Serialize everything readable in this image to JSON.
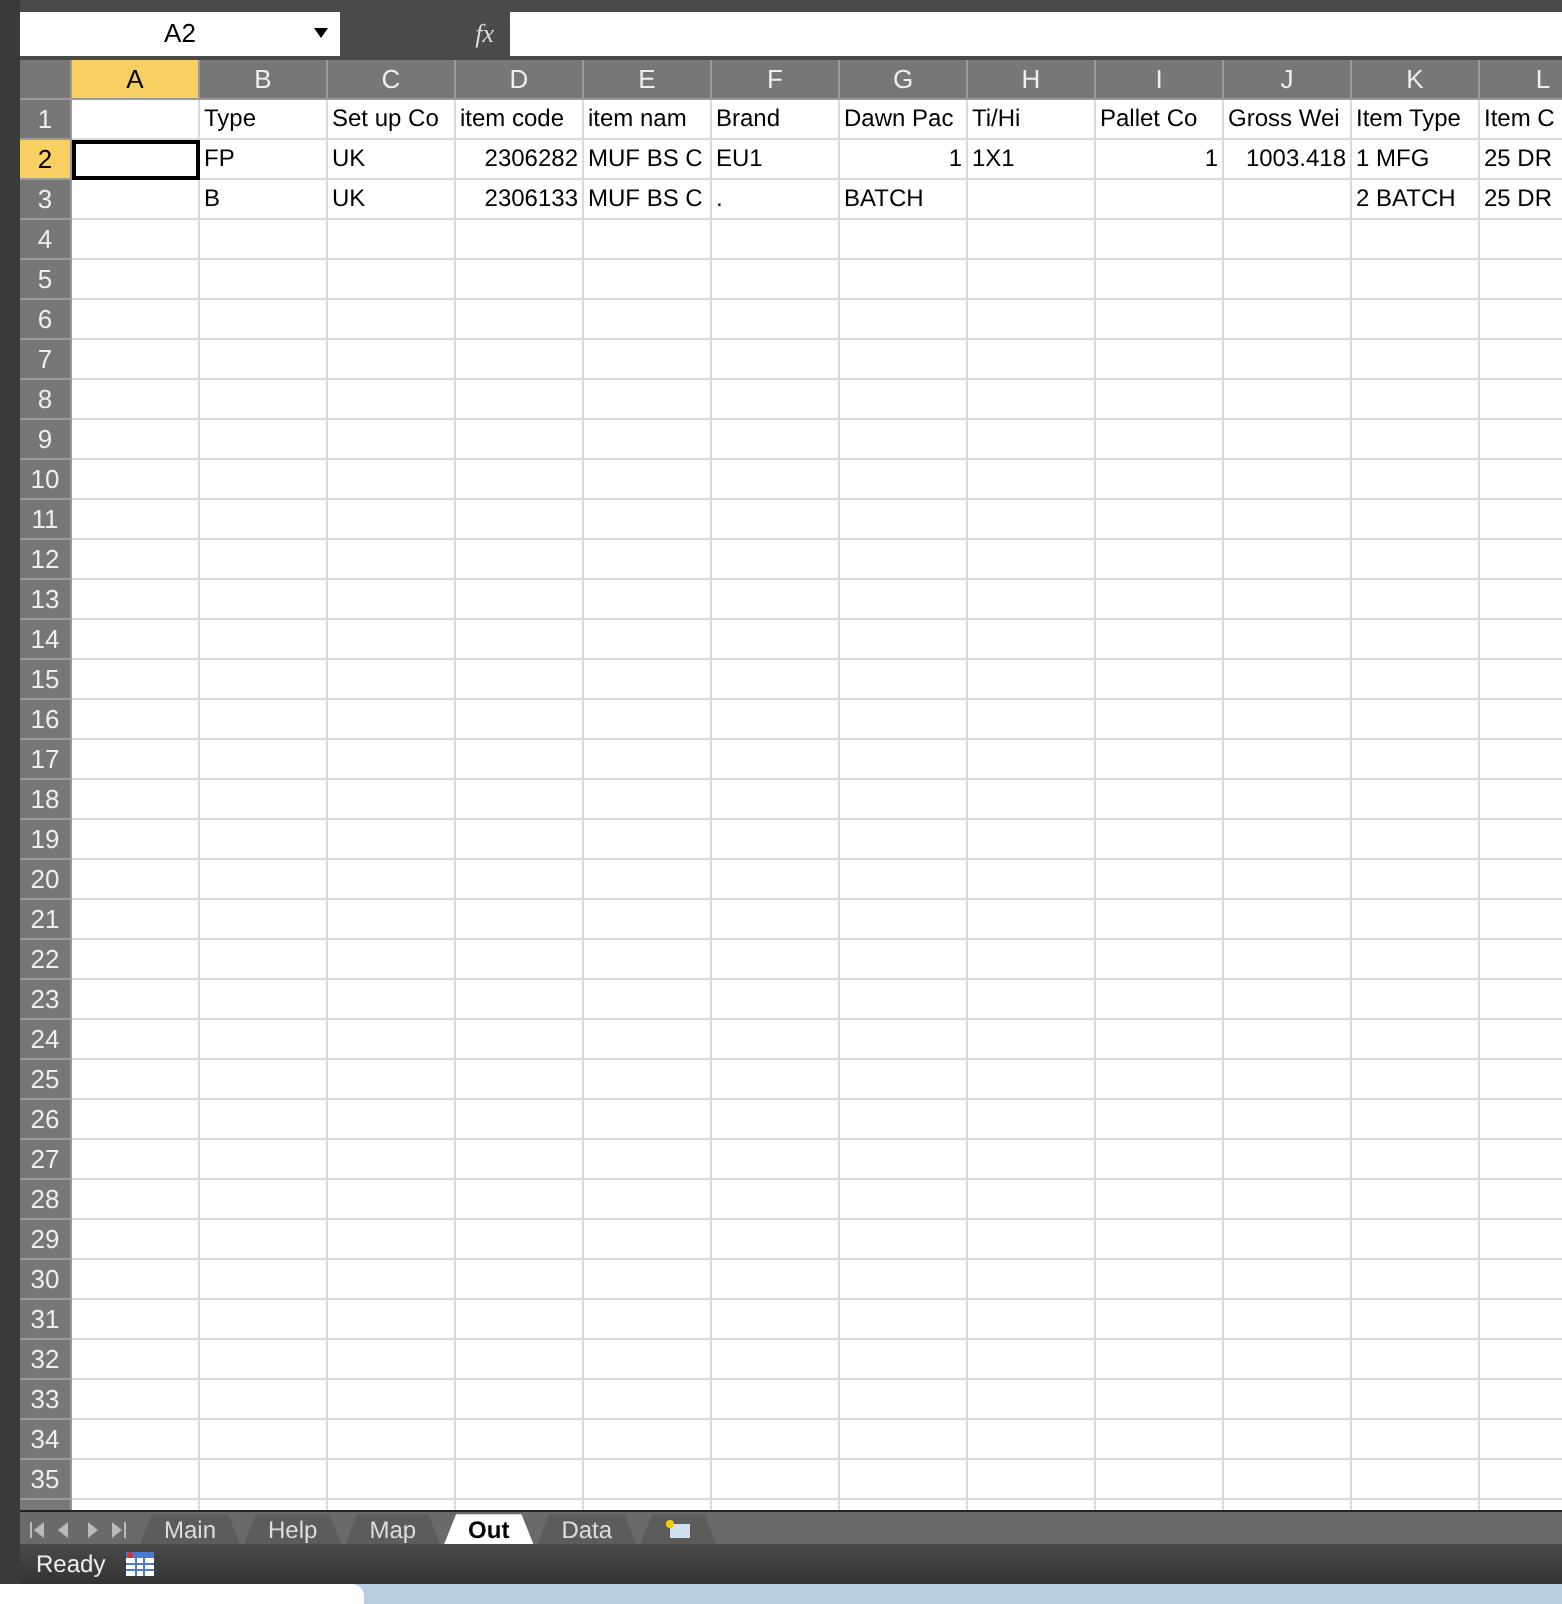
{
  "formula_bar": {
    "name_box": "A2",
    "function_label": "fx"
  },
  "columns": [
    {
      "label": "A",
      "selected": true
    },
    {
      "label": "B",
      "selected": false
    },
    {
      "label": "C",
      "selected": false
    },
    {
      "label": "D",
      "selected": false
    },
    {
      "label": "E",
      "selected": false
    },
    {
      "label": "F",
      "selected": false
    },
    {
      "label": "G",
      "selected": false
    },
    {
      "label": "H",
      "selected": false
    },
    {
      "label": "I",
      "selected": false
    },
    {
      "label": "J",
      "selected": false
    },
    {
      "label": "K",
      "selected": false
    },
    {
      "label": "L",
      "selected": false
    }
  ],
  "rows": [
    {
      "number": "1",
      "selected": false,
      "cells": {
        "B": {
          "text": "Type"
        },
        "C": {
          "text": "Set up Co"
        },
        "D": {
          "text": "item code"
        },
        "E": {
          "text": "item nam"
        },
        "F": {
          "text": "Brand"
        },
        "G": {
          "text": "Dawn Pac"
        },
        "H": {
          "text": "Ti/Hi"
        },
        "I": {
          "text": "Pallet Co"
        },
        "J": {
          "text": "Gross Wei"
        },
        "K": {
          "text": "Item Type"
        },
        "L": {
          "text": "Item C"
        }
      }
    },
    {
      "number": "2",
      "selected": true,
      "cells": {
        "B": {
          "text": "FP"
        },
        "C": {
          "text": "UK"
        },
        "D": {
          "text": "2306282",
          "numeric": true
        },
        "E": {
          "text": "MUF BS C"
        },
        "F": {
          "text": "EU1"
        },
        "G": {
          "text": "1",
          "numeric": true
        },
        "H": {
          "text": "1X1"
        },
        "I": {
          "text": "1",
          "numeric": true
        },
        "J": {
          "text": "1003.418",
          "numeric": true
        },
        "K": {
          "text": "1 MFG"
        },
        "L": {
          "text": "25 DR"
        }
      }
    },
    {
      "number": "3",
      "selected": false,
      "cells": {
        "B": {
          "text": "B"
        },
        "C": {
          "text": "UK"
        },
        "D": {
          "text": "2306133",
          "numeric": true
        },
        "E": {
          "text": "MUF BS C"
        },
        "F": {
          "text": "."
        },
        "G": {
          "text": "BATCH"
        },
        "K": {
          "text": "2 BATCH"
        },
        "L": {
          "text": "25 DR"
        }
      }
    },
    {
      "number": "4",
      "selected": false
    },
    {
      "number": "5",
      "selected": false
    },
    {
      "number": "6",
      "selected": false
    },
    {
      "number": "7",
      "selected": false
    },
    {
      "number": "8",
      "selected": false
    },
    {
      "number": "9",
      "selected": false
    },
    {
      "number": "10",
      "selected": false
    },
    {
      "number": "11",
      "selected": false
    },
    {
      "number": "12",
      "selected": false
    },
    {
      "number": "13",
      "selected": false
    },
    {
      "number": "14",
      "selected": false
    },
    {
      "number": "15",
      "selected": false
    },
    {
      "number": "16",
      "selected": false
    },
    {
      "number": "17",
      "selected": false
    },
    {
      "number": "18",
      "selected": false
    },
    {
      "number": "19",
      "selected": false
    },
    {
      "number": "20",
      "selected": false
    },
    {
      "number": "21",
      "selected": false
    },
    {
      "number": "22",
      "selected": false
    },
    {
      "number": "23",
      "selected": false
    },
    {
      "number": "24",
      "selected": false
    },
    {
      "number": "25",
      "selected": false
    },
    {
      "number": "26",
      "selected": false
    },
    {
      "number": "27",
      "selected": false
    },
    {
      "number": "28",
      "selected": false
    },
    {
      "number": "29",
      "selected": false
    },
    {
      "number": "30",
      "selected": false
    },
    {
      "number": "31",
      "selected": false
    },
    {
      "number": "32",
      "selected": false
    },
    {
      "number": "33",
      "selected": false
    },
    {
      "number": "34",
      "selected": false
    },
    {
      "number": "35",
      "selected": false
    }
  ],
  "sheet_tabs": [
    {
      "label": "Main",
      "selected": false
    },
    {
      "label": "Help",
      "selected": false
    },
    {
      "label": "Map",
      "selected": false
    },
    {
      "label": "Out",
      "selected": true
    },
    {
      "label": "Data",
      "selected": false
    }
  ],
  "status_bar": {
    "text": "Ready"
  }
}
